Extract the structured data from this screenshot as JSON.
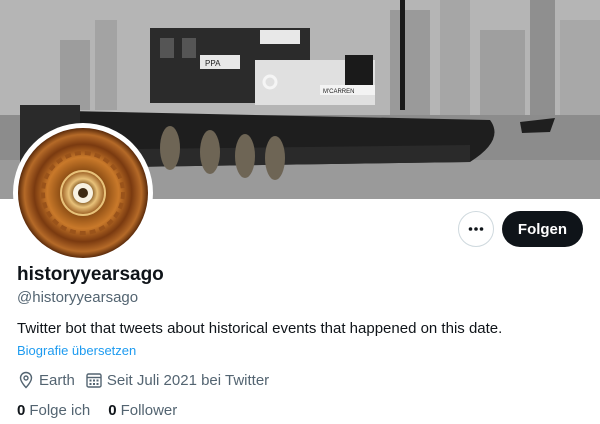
{
  "profile": {
    "display_name": "historyyearsago",
    "handle": "@historyyearsago",
    "bio": "Twitter bot that tweets about historical events that happened on this date.",
    "translate_link": "Biografie übersetzen",
    "location": "Earth",
    "joined": "Seit Juli 2021 bei Twitter"
  },
  "actions": {
    "follow_label": "Folgen",
    "more_icon": "more-horizontal-icon"
  },
  "stats": {
    "following_count": "0",
    "following_label": "Folge ich",
    "followers_count": "0",
    "followers_label": "Follower"
  },
  "banner": {
    "boat_sign_left": "PPA",
    "boat_sign_right": "M'CARREN"
  },
  "colors": {
    "accent": "#1d9bf0",
    "primary_text": "#0f1419",
    "secondary_text": "#536471",
    "button_bg": "#0f1419"
  }
}
